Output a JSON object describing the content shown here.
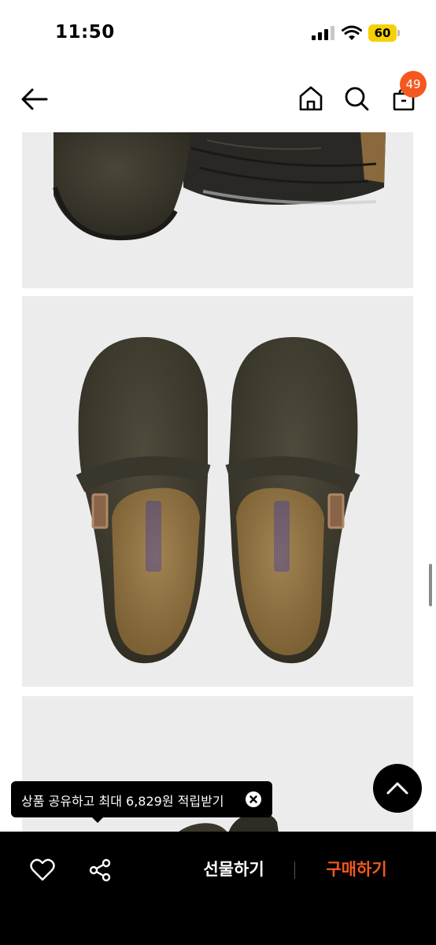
{
  "status_bar": {
    "time": "11:50",
    "battery_level": "60"
  },
  "header": {
    "back_icon": "arrow-left-icon",
    "home_icon": "home-icon",
    "search_icon": "search-icon",
    "bag_icon": "shopping-bag-icon",
    "cart_count": "49"
  },
  "product_images": [
    {
      "view": "sole"
    },
    {
      "view": "top"
    },
    {
      "view": "side"
    }
  ],
  "tooltip": {
    "text": "상품 공유하고 최대 6,829원 적립받기"
  },
  "bottom_bar": {
    "gift_label": "선물하기",
    "buy_label": "구매하기"
  },
  "colors": {
    "accent": "#f4581e",
    "battery": "#f5d104",
    "image_background": "#ececec",
    "bottom_bar": "#000000"
  }
}
